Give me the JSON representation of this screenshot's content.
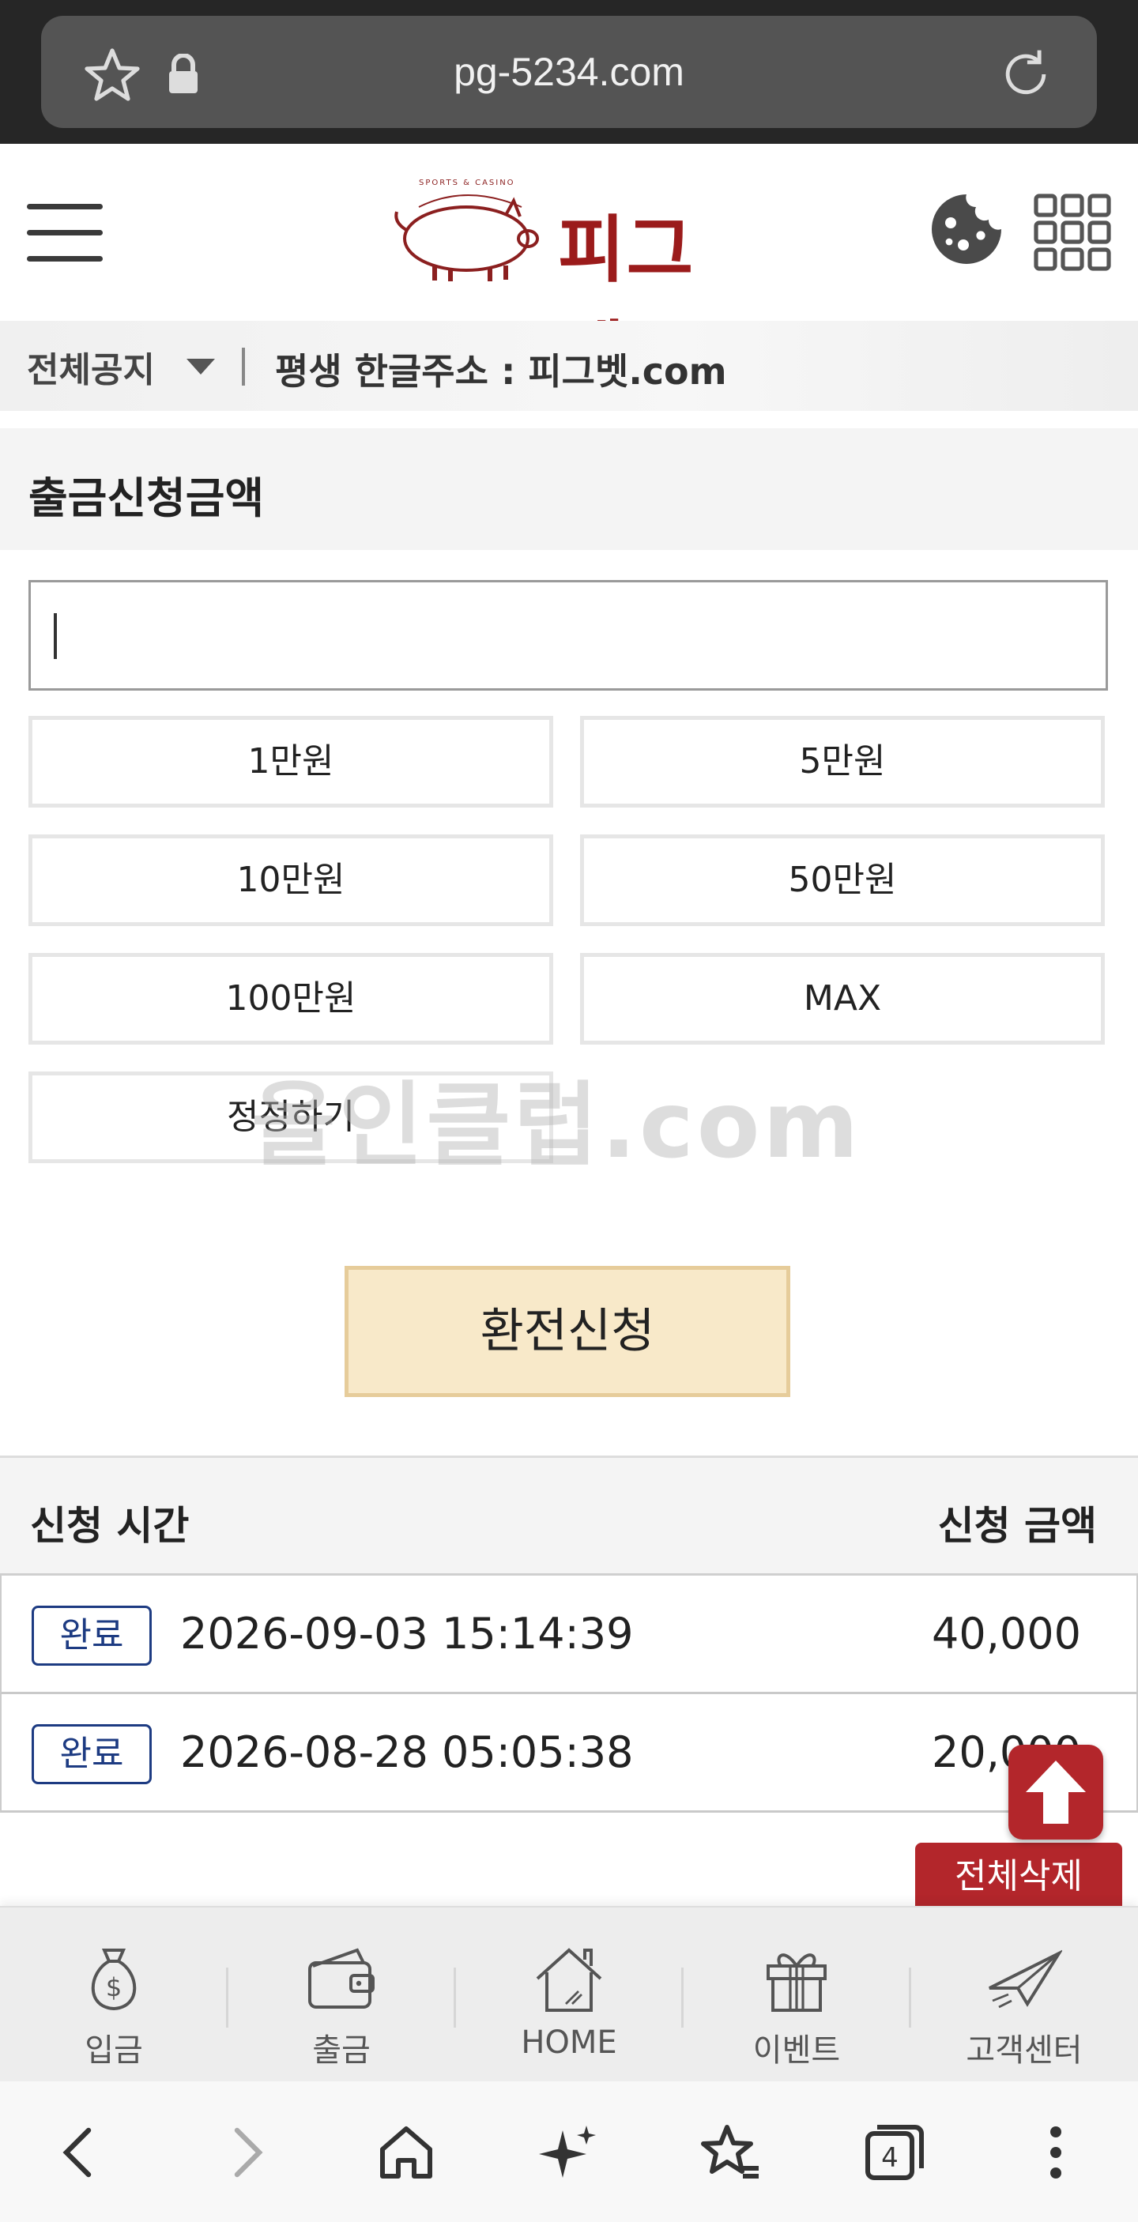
{
  "browser": {
    "url": "pg-5234.com",
    "tab_count": "4"
  },
  "header": {
    "logo_text": "피그벳",
    "logo_tagline": "SPORTS & CASINO"
  },
  "notice": {
    "label": "전체공지",
    "text": "평생 한글주소 : 피그벳.com"
  },
  "withdraw": {
    "title": "출금신청금액",
    "input_value": "",
    "amount_buttons": [
      "1만원",
      "5만원",
      "10만원",
      "50만원",
      "100만원",
      "MAX"
    ],
    "reset_label": "정정하기",
    "submit_label": "환전신청"
  },
  "watermark": "올인클럽.com",
  "history": {
    "columns": [
      "신청 시간",
      "신청 금액"
    ],
    "rows": [
      {
        "status": "완료",
        "time": "2026-09-03 15:14:39",
        "amount": "40,000"
      },
      {
        "status": "완료",
        "time": "2026-08-28 05:05:38",
        "amount": "20,000"
      }
    ],
    "delete_all_label": "전체삭제"
  },
  "site_nav": [
    "입금",
    "출금",
    "HOME",
    "이벤트",
    "고객센터"
  ],
  "colors": {
    "brand_red": "#b3262b",
    "badge_blue": "#1d3b82",
    "submit_bg": "#f8e9c9"
  }
}
